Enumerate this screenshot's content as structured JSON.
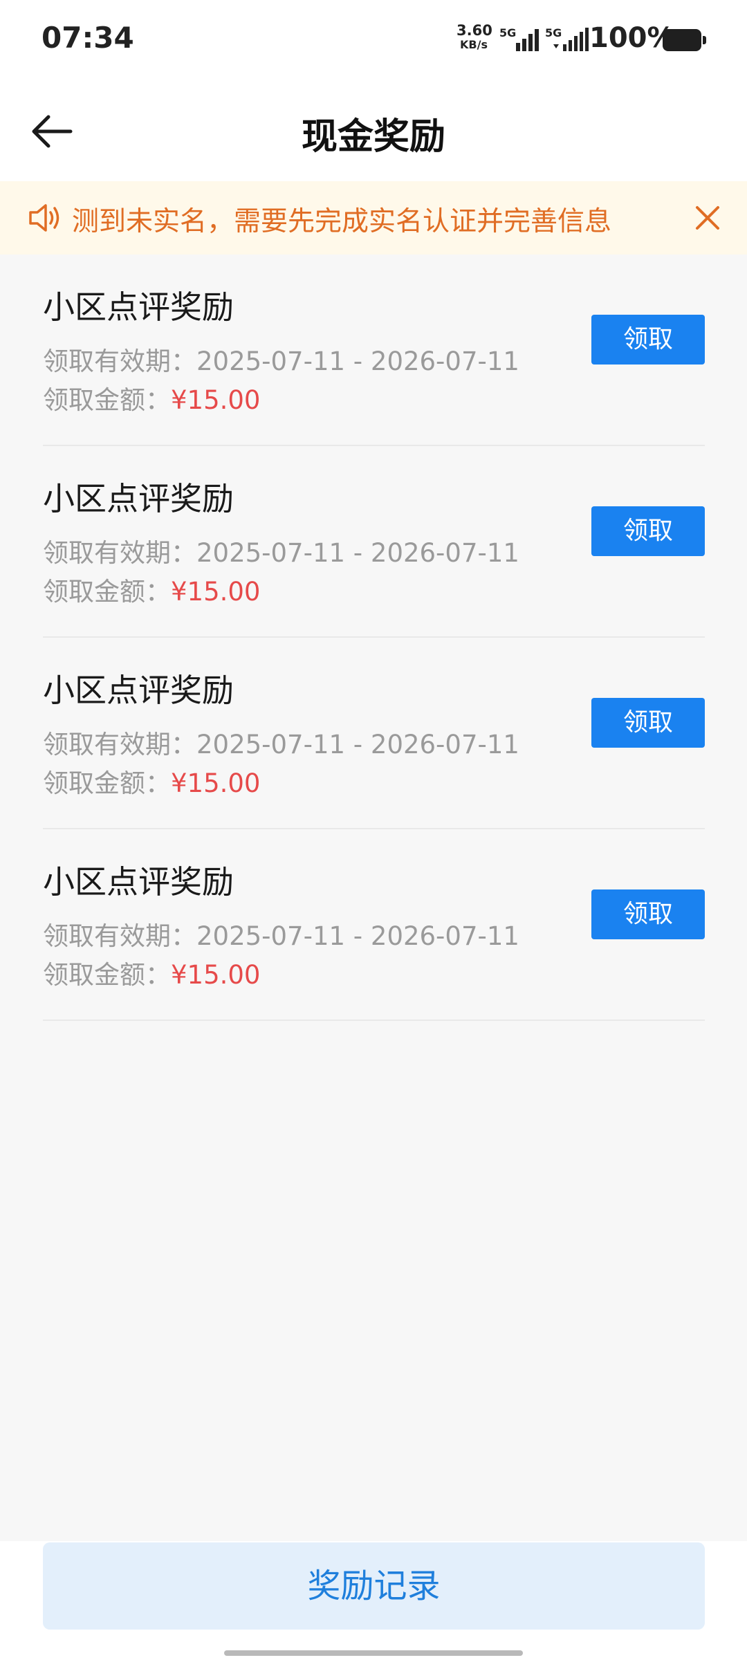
{
  "status_bar": {
    "time": "07:34",
    "net_speed_value": "3.60",
    "net_speed_unit": "KB/s",
    "sim1_label": "5G",
    "sim2_label": "5G",
    "battery_percent": "100%"
  },
  "nav": {
    "title": "现金奖励",
    "back_icon": "arrow-left-icon"
  },
  "notice": {
    "icon": "speaker-icon",
    "text": "测到未实名，需要先完成实名认证并完善信息",
    "close_icon": "close-icon"
  },
  "rewards": [
    {
      "title": "小区点评奖励",
      "validity_label": "领取有效期：",
      "validity": "2025-07-11 - 2026-07-11",
      "amount_label": "领取金额：",
      "amount": "¥15.00",
      "button": "领取"
    },
    {
      "title": "小区点评奖励",
      "validity_label": "领取有效期：",
      "validity": "2025-07-11 - 2026-07-11",
      "amount_label": "领取金额：",
      "amount": "¥15.00",
      "button": "领取"
    },
    {
      "title": "小区点评奖励",
      "validity_label": "领取有效期：",
      "validity": "2025-07-11 - 2026-07-11",
      "amount_label": "领取金额：",
      "amount": "¥15.00",
      "button": "领取"
    },
    {
      "title": "小区点评奖励",
      "validity_label": "领取有效期：",
      "validity": "2025-07-11 - 2026-07-11",
      "amount_label": "领取金额：",
      "amount": "¥15.00",
      "button": "领取"
    }
  ],
  "footer": {
    "record_button": "奖励记录"
  },
  "colors": {
    "primary": "#1a82f0",
    "notice_text": "#e06d24",
    "amount": "#e64a4a"
  }
}
